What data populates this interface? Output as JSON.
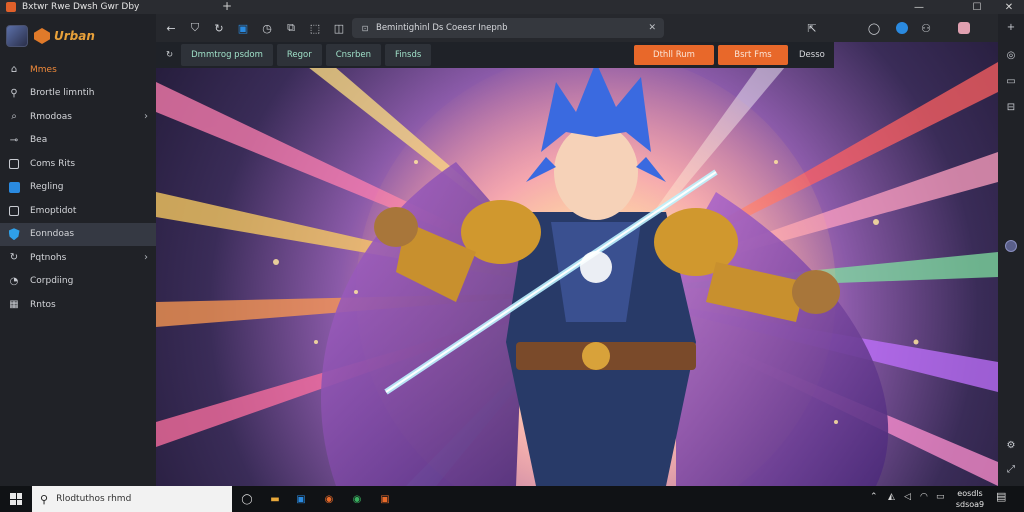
{
  "window": {
    "title": "Bxtwr Rwe Dwsh Gwr Dby",
    "controls": {
      "minimize": "—",
      "maximize": "☐",
      "close": "✕"
    }
  },
  "brand": {
    "name": "Urban"
  },
  "sidebar": {
    "items": [
      {
        "label": "Mmes",
        "icon": "home-icon"
      },
      {
        "label": "Brortle limntih",
        "icon": "search-icon"
      },
      {
        "label": "Rmodoas",
        "icon": "magnifier-icon"
      },
      {
        "label": "Bea",
        "icon": "link-icon"
      },
      {
        "label": "Coms Rits",
        "icon": "box-icon"
      },
      {
        "label": "Regling",
        "icon": "blue-square-icon"
      },
      {
        "label": "Emoptidot",
        "icon": "box-icon"
      },
      {
        "label": "Eonndoas",
        "icon": "shield-icon"
      },
      {
        "label": "Pqtnohs",
        "icon": "refresh-icon"
      },
      {
        "label": "Corpdiing",
        "icon": "chat-icon"
      },
      {
        "label": "Rntos",
        "icon": "grid-icon"
      }
    ]
  },
  "toolbar": {
    "url": "Bemintighinl Ds Coeesr Inepnb"
  },
  "pagenav": {
    "items": [
      "Dmmtrog psdom",
      "Regor",
      "Cnsrben",
      "Finsds"
    ],
    "buttons": [
      "Dthll Rum",
      "Bsrt Fms"
    ],
    "plain": "Desso"
  },
  "taskbar": {
    "search_placeholder": "Rlodtuthos rhmd",
    "time": "eosdls",
    "date": "sdsoa9"
  },
  "colors": {
    "accent": "#e8682a",
    "brand": "#e8a13a",
    "active_item_bg": "#353943"
  }
}
